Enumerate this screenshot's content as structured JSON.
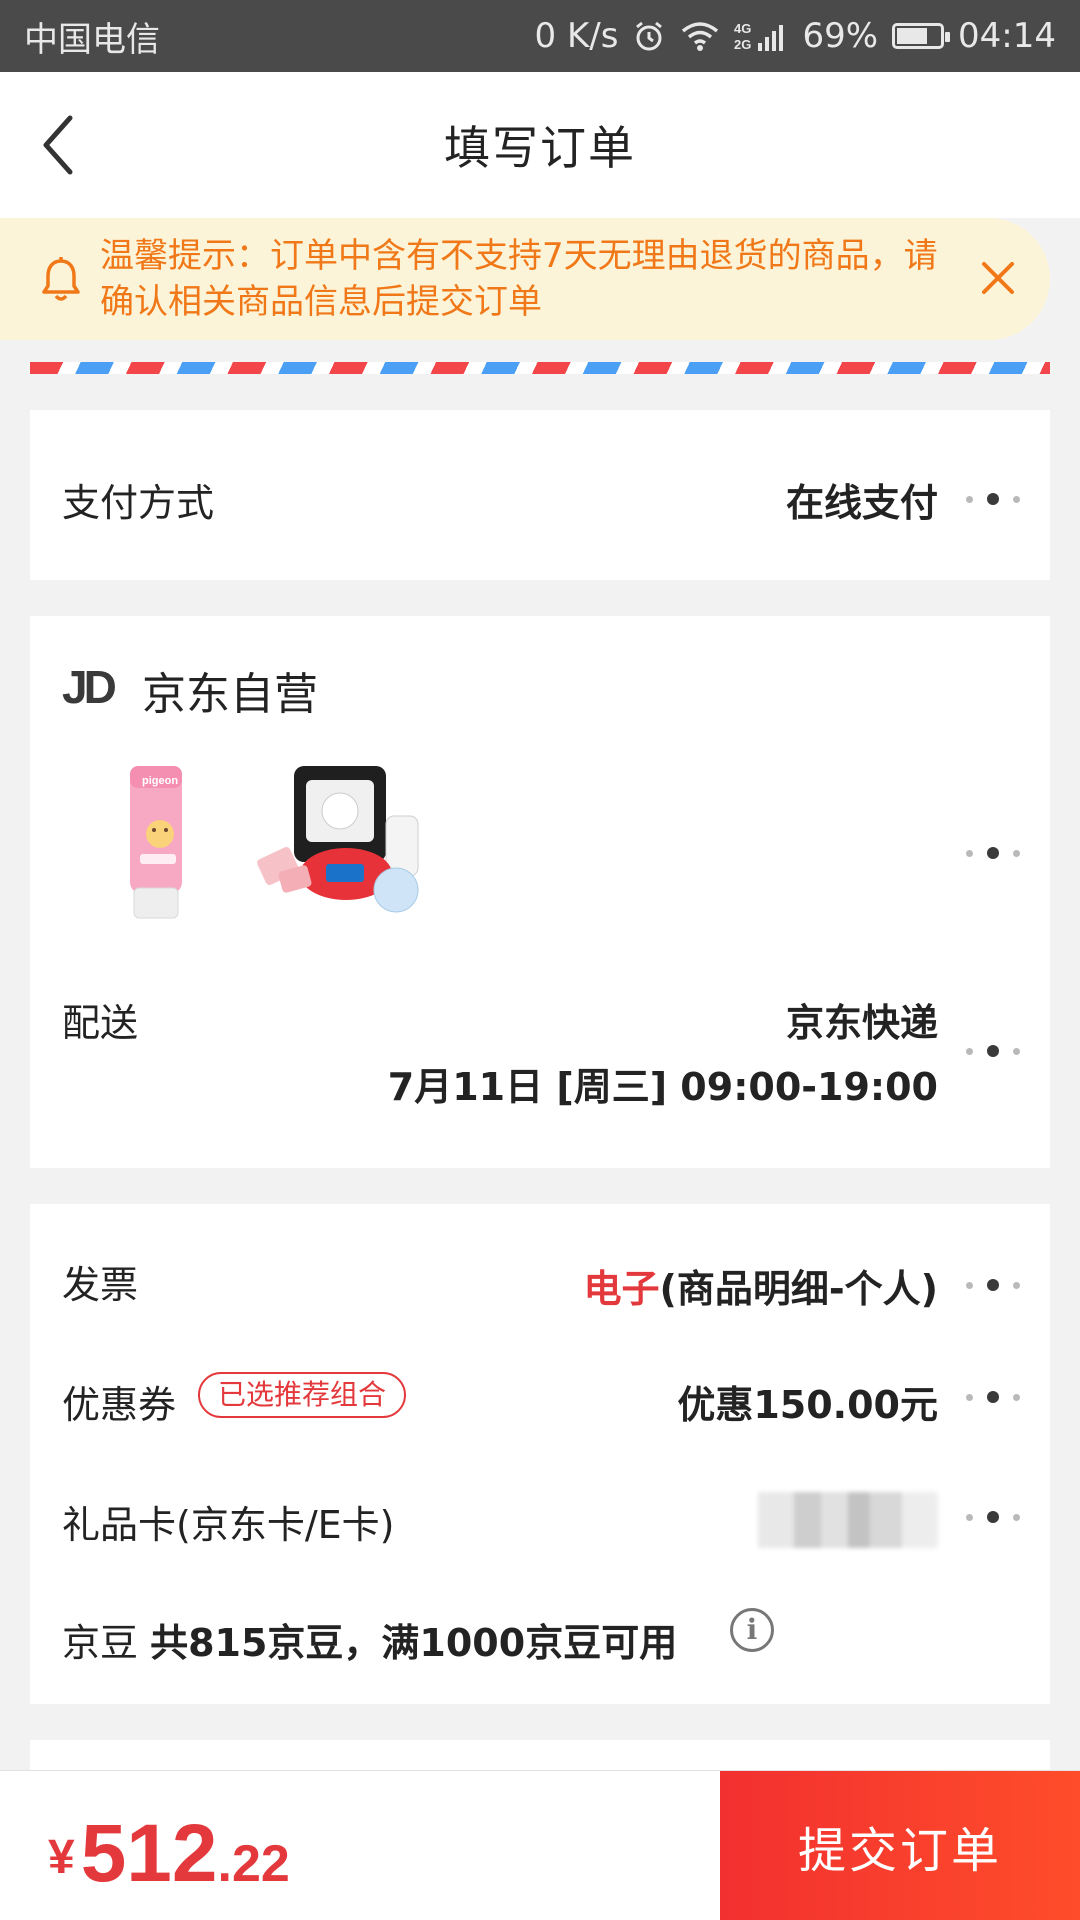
{
  "status_bar": {
    "carrier": "中国电信",
    "net_speed": "0 K/s",
    "network": "4G 2G",
    "battery_percent": "69%",
    "time": "04:14"
  },
  "nav": {
    "title": "填写订单"
  },
  "notice": {
    "text": "温馨提示：订单中含有不支持7天无理由退货的商品，请确认相关商品信息后提交订单"
  },
  "payment": {
    "label": "支付方式",
    "value": "在线支付"
  },
  "shop": {
    "logo": "JD",
    "name": "京东自营",
    "products": [
      {
        "name": "pigeon"
      },
      {
        "name": ""
      }
    ]
  },
  "delivery": {
    "label": "配送",
    "carrier": "京东快递",
    "time": "7月11日 [周三] 09:00-19:00"
  },
  "invoice": {
    "label": "发票",
    "type": "电子",
    "detail": "(商品明细-个人)"
  },
  "coupon": {
    "label": "优惠券",
    "badge": "已选推荐组合",
    "value": "优惠150.00元"
  },
  "giftcard": {
    "label": "礼品卡(京东卡/E卡)"
  },
  "jingdou": {
    "label": "京豆",
    "text": "共815京豆，满1000京豆可用"
  },
  "footer": {
    "currency": "¥",
    "price_int": "512",
    "price_dec": ".22",
    "submit_label": "提交订单"
  },
  "colors": {
    "accent_red": "#e4393c",
    "notice_orange": "#f07818",
    "notice_bg": "#fcf4d8"
  },
  "icons": [
    "back-arrow-icon",
    "bell-icon",
    "close-icon",
    "more-dots-icon",
    "info-icon",
    "wifi-icon",
    "alarm-icon",
    "signal-icon",
    "battery-icon"
  ]
}
